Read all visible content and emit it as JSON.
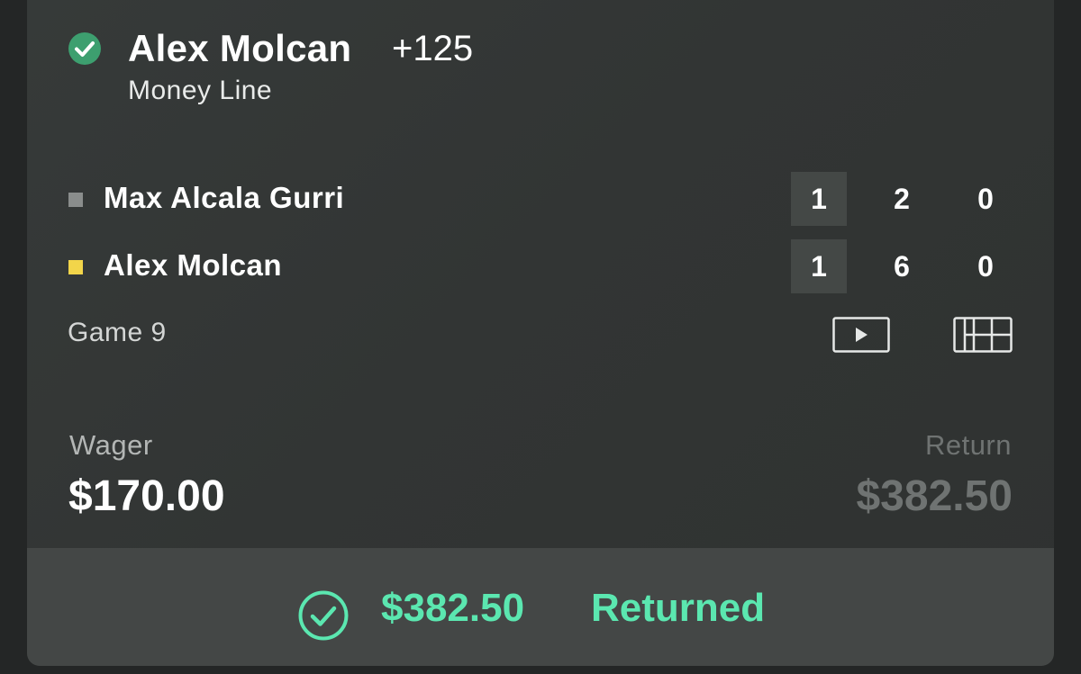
{
  "bet": {
    "selection": "Alex Molcan",
    "odds": "+125",
    "market": "Money Line",
    "status_icon": "check-circle-icon",
    "status_color": "#3d9f6f"
  },
  "match": {
    "players": [
      {
        "name": "Max Alcala Gurri",
        "marker_color": "#8a8d8c",
        "sets": [
          "1",
          "2",
          "0"
        ]
      },
      {
        "name": "Alex Molcan",
        "marker_color": "#f2d54a",
        "sets": [
          "1",
          "6",
          "0"
        ]
      }
    ],
    "status": "Game 9",
    "icons": [
      "play-video-icon",
      "scoreboard-grid-icon"
    ]
  },
  "wager": {
    "label": "Wager",
    "amount": "$170.00"
  },
  "return": {
    "label": "Return",
    "amount": "$382.50"
  },
  "footer": {
    "icon": "check-circle-icon",
    "amount": "$382.50",
    "label": "Returned",
    "accent_color": "#5be7b0"
  }
}
